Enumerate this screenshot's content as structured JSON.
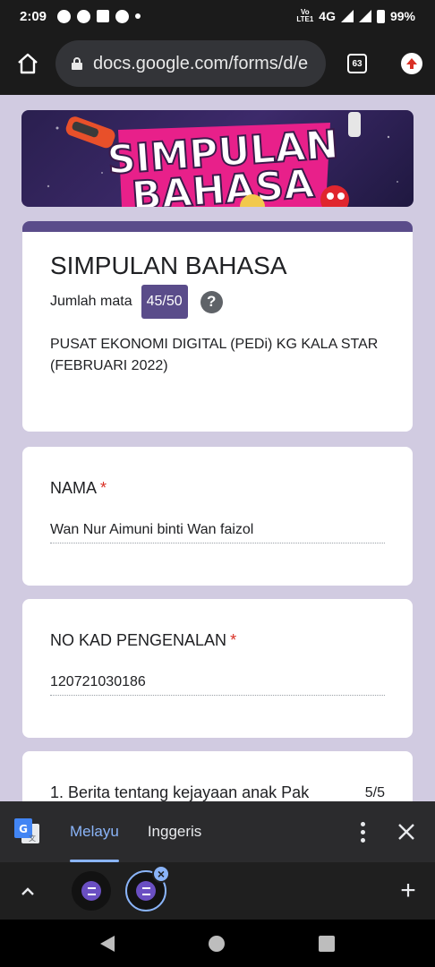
{
  "status_bar": {
    "time": "2:09",
    "network": "4G",
    "volte": "Vo\nLTE1",
    "battery": "99%"
  },
  "browser": {
    "url": "docs.google.com/forms/d/e",
    "tab_count": "63"
  },
  "form": {
    "title": "SIMPULAN BAHASA",
    "score_label": "Jumlah mata",
    "score_value": "45/50",
    "help_icon": "?",
    "description_lines": [
      "PUSAT EKONOMI DIGITAL (PEDi) KG KALA STAR",
      "(FEBRUARI 2022)"
    ]
  },
  "questions": [
    {
      "label": "NAMA",
      "required_mark": "*",
      "answer": "Wan Nur Aimuni binti Wan faizol"
    },
    {
      "label": "NO KAD PENGENALAN",
      "required_mark": "*",
      "answer": "120721030186"
    }
  ],
  "question_preview": {
    "text": "1. Berita tentang kejayaan anak Pak",
    "score": "5/5"
  },
  "translate_bar": {
    "lang_active": "Melayu",
    "lang_other": "Inggeris"
  },
  "tab_strip": {
    "add_label": "+"
  },
  "colors": {
    "accent": "#5a4c8a",
    "page_bg": "#d1cbe1",
    "required": "#d93025",
    "link_blue": "#8ab4f8"
  }
}
